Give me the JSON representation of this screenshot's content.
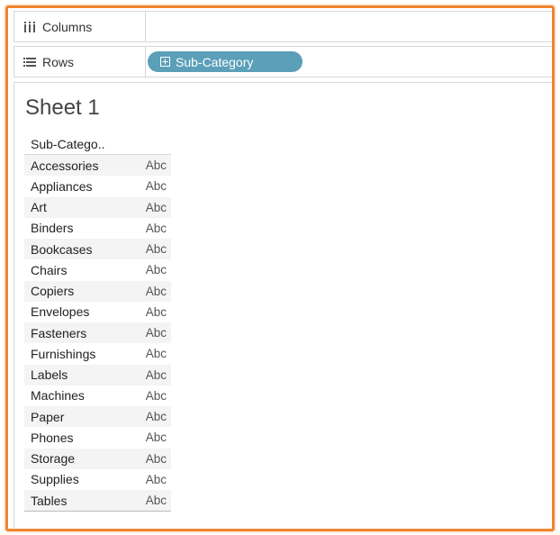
{
  "shelves": {
    "columns": {
      "label": "Columns",
      "icon": "columns-icon"
    },
    "rows": {
      "label": "Rows",
      "icon": "rows-icon",
      "pill": {
        "label": "Sub-Category",
        "icon": "plus-box-icon"
      }
    }
  },
  "sheet": {
    "title": "Sheet 1"
  },
  "table": {
    "header": "Sub-Catego..",
    "rows": [
      {
        "name": "Accessories",
        "value": "Abc"
      },
      {
        "name": "Appliances",
        "value": "Abc"
      },
      {
        "name": "Art",
        "value": "Abc"
      },
      {
        "name": "Binders",
        "value": "Abc"
      },
      {
        "name": "Bookcases",
        "value": "Abc"
      },
      {
        "name": "Chairs",
        "value": "Abc"
      },
      {
        "name": "Copiers",
        "value": "Abc"
      },
      {
        "name": "Envelopes",
        "value": "Abc"
      },
      {
        "name": "Fasteners",
        "value": "Abc"
      },
      {
        "name": "Furnishings",
        "value": "Abc"
      },
      {
        "name": "Labels",
        "value": "Abc"
      },
      {
        "name": "Machines",
        "value": "Abc"
      },
      {
        "name": "Paper",
        "value": "Abc"
      },
      {
        "name": "Phones",
        "value": "Abc"
      },
      {
        "name": "Storage",
        "value": "Abc"
      },
      {
        "name": "Supplies",
        "value": "Abc"
      },
      {
        "name": "Tables",
        "value": "Abc"
      }
    ]
  },
  "colors": {
    "frame": "#f0852f",
    "pill": "#5b9fb8"
  }
}
